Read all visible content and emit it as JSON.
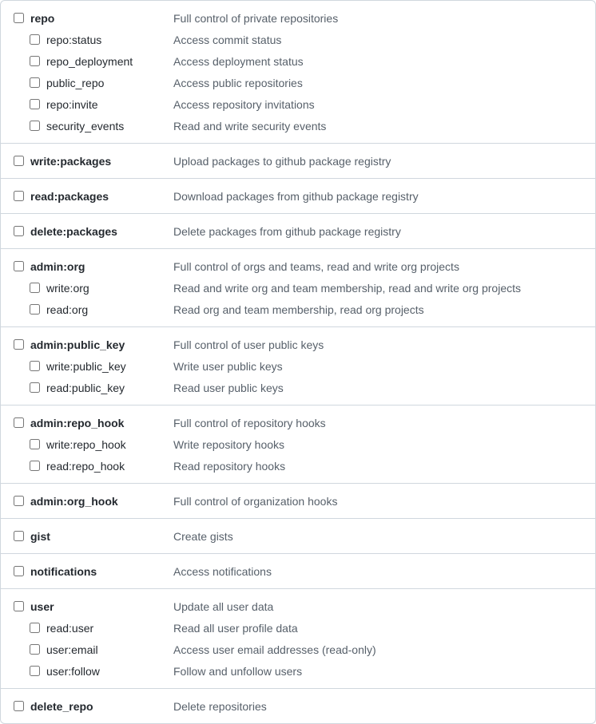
{
  "scopes": [
    {
      "name": "repo",
      "desc": "Full control of private repositories",
      "children": [
        {
          "name": "repo:status",
          "desc": "Access commit status"
        },
        {
          "name": "repo_deployment",
          "desc": "Access deployment status"
        },
        {
          "name": "public_repo",
          "desc": "Access public repositories"
        },
        {
          "name": "repo:invite",
          "desc": "Access repository invitations"
        },
        {
          "name": "security_events",
          "desc": "Read and write security events"
        }
      ]
    },
    {
      "name": "write:packages",
      "desc": "Upload packages to github package registry",
      "children": []
    },
    {
      "name": "read:packages",
      "desc": "Download packages from github package registry",
      "children": []
    },
    {
      "name": "delete:packages",
      "desc": "Delete packages from github package registry",
      "children": []
    },
    {
      "name": "admin:org",
      "desc": "Full control of orgs and teams, read and write org projects",
      "children": [
        {
          "name": "write:org",
          "desc": "Read and write org and team membership, read and write org projects"
        },
        {
          "name": "read:org",
          "desc": "Read org and team membership, read org projects"
        }
      ]
    },
    {
      "name": "admin:public_key",
      "desc": "Full control of user public keys",
      "children": [
        {
          "name": "write:public_key",
          "desc": "Write user public keys"
        },
        {
          "name": "read:public_key",
          "desc": "Read user public keys"
        }
      ]
    },
    {
      "name": "admin:repo_hook",
      "desc": "Full control of repository hooks",
      "children": [
        {
          "name": "write:repo_hook",
          "desc": "Write repository hooks"
        },
        {
          "name": "read:repo_hook",
          "desc": "Read repository hooks"
        }
      ]
    },
    {
      "name": "admin:org_hook",
      "desc": "Full control of organization hooks",
      "children": []
    },
    {
      "name": "gist",
      "desc": "Create gists",
      "children": []
    },
    {
      "name": "notifications",
      "desc": "Access notifications",
      "children": []
    },
    {
      "name": "user",
      "desc": "Update all user data",
      "children": [
        {
          "name": "read:user",
          "desc": "Read all user profile data"
        },
        {
          "name": "user:email",
          "desc": "Access user email addresses (read-only)"
        },
        {
          "name": "user:follow",
          "desc": "Follow and unfollow users"
        }
      ]
    },
    {
      "name": "delete_repo",
      "desc": "Delete repositories",
      "children": []
    }
  ]
}
